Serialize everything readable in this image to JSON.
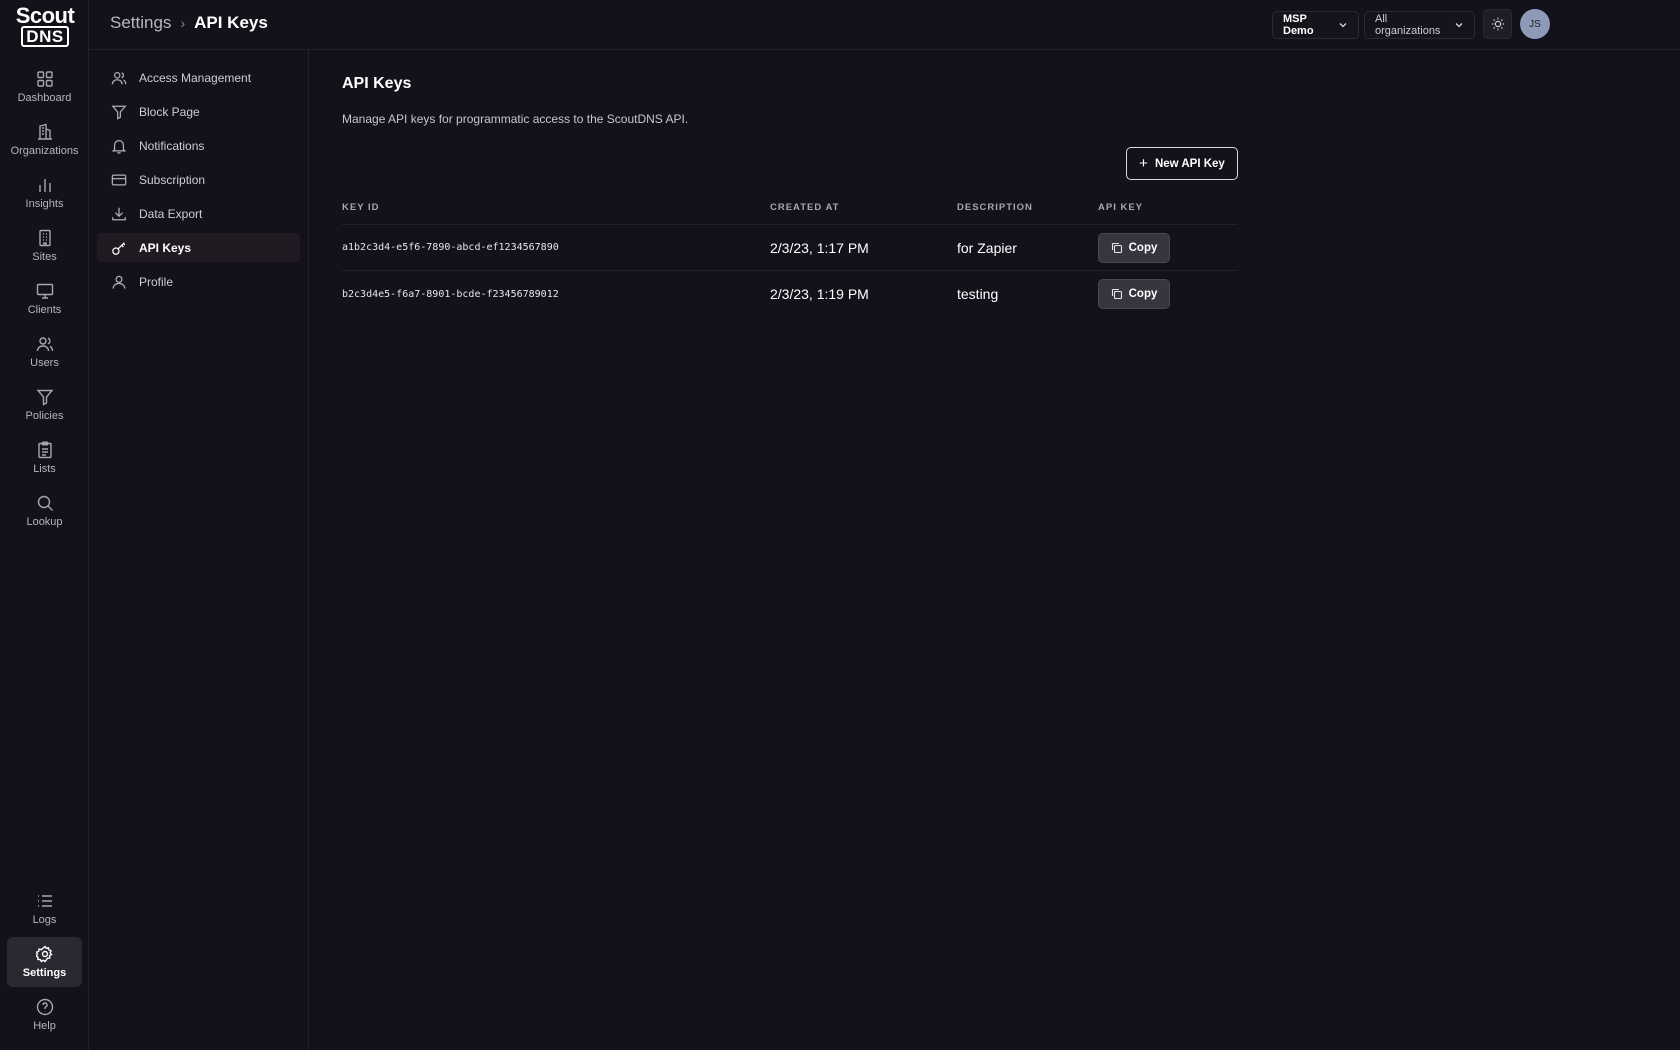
{
  "app": {
    "logo_line1": "Scout",
    "logo_line2": "DNS"
  },
  "rail": {
    "items": [
      {
        "label": "Dashboard",
        "icon": "dashboard-grid-icon"
      },
      {
        "label": "Organizations",
        "icon": "building-icon"
      },
      {
        "label": "Insights",
        "icon": "bar-chart-icon"
      },
      {
        "label": "Sites",
        "icon": "office-building-icon"
      },
      {
        "label": "Clients",
        "icon": "monitor-icon"
      },
      {
        "label": "Users",
        "icon": "users-icon"
      },
      {
        "label": "Policies",
        "icon": "filter-icon"
      },
      {
        "label": "Lists",
        "icon": "clipboard-list-icon"
      },
      {
        "label": "Lookup",
        "icon": "search-icon"
      }
    ],
    "bottom": [
      {
        "label": "Logs",
        "icon": "list-icon"
      },
      {
        "label": "Settings",
        "icon": "gear-icon",
        "active": true
      },
      {
        "label": "Help",
        "icon": "help-circle-icon"
      }
    ]
  },
  "header": {
    "breadcrumb_parent": "Settings",
    "breadcrumb_sep": "›",
    "breadcrumb_current": "API Keys",
    "tenant_select": "MSP Demo",
    "org_select": "All organizations",
    "theme_toggle_icon": "sun-icon",
    "avatar_initials": "JS"
  },
  "settings_nav": {
    "items": [
      {
        "label": "Access Management",
        "icon": "users-icon"
      },
      {
        "label": "Block Page",
        "icon": "filter-icon"
      },
      {
        "label": "Notifications",
        "icon": "bell-icon"
      },
      {
        "label": "Subscription",
        "icon": "credit-card-icon"
      },
      {
        "label": "Data Export",
        "icon": "download-icon"
      },
      {
        "label": "API Keys",
        "icon": "key-icon",
        "active": true
      },
      {
        "label": "Profile",
        "icon": "user-icon"
      }
    ]
  },
  "main": {
    "title": "API Keys",
    "description": "Manage API keys for programmatic access to the ScoutDNS API.",
    "new_button_label": "New API Key",
    "columns": [
      "KEY ID",
      "CREATED AT",
      "DESCRIPTION",
      "API KEY"
    ],
    "rows": [
      {
        "key_id": "a1b2c3d4-e5f6-7890-abcd-ef1234567890",
        "created_at": "2/3/23, 1:17 PM",
        "description": "for Zapier",
        "action": "Copy"
      },
      {
        "key_id": "b2c3d4e5-f6a7-8901-bcde-f23456789012",
        "created_at": "2/3/23, 1:19 PM",
        "description": "testing",
        "action": "Copy"
      }
    ]
  },
  "colors": {
    "background": "#13111a",
    "active_nav": "#221a22",
    "avatar": "#8d9bb8"
  }
}
